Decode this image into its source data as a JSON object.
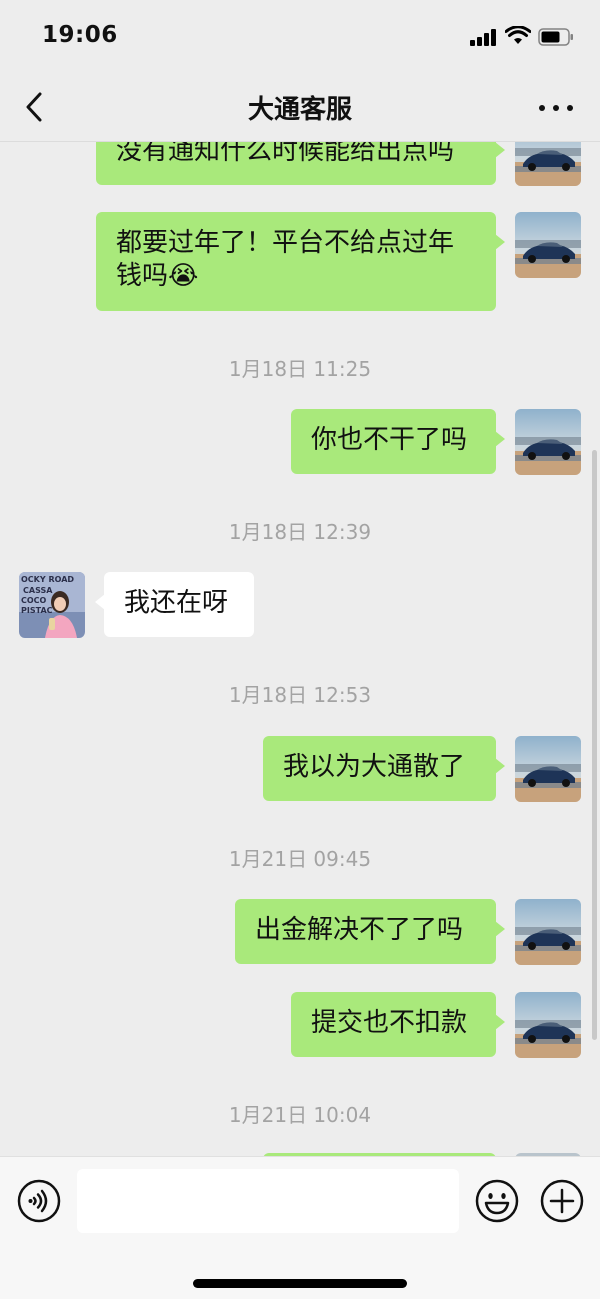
{
  "status": {
    "time": "19:06"
  },
  "nav": {
    "title": "大通客服"
  },
  "messages": [
    {
      "side": "mine",
      "text": "没有通知什么时候能给出点吗"
    },
    {
      "side": "mine",
      "text": "都要过年了！平台不给点过年钱吗😭"
    },
    {
      "type": "timestamp",
      "text": "1月18日 11:25"
    },
    {
      "side": "mine",
      "text": "你也不干了吗"
    },
    {
      "type": "timestamp",
      "text": "1月18日 12:39"
    },
    {
      "side": "other",
      "text": "我还在呀"
    },
    {
      "type": "timestamp",
      "text": "1月18日 12:53"
    },
    {
      "side": "mine",
      "text": "我以为大通散了"
    },
    {
      "type": "timestamp",
      "text": "1月21日 09:45"
    },
    {
      "side": "mine",
      "text": "出金解决不了了吗"
    },
    {
      "side": "mine",
      "text": "提交也不扣款"
    },
    {
      "type": "timestamp",
      "text": "1月21日 10:04"
    }
  ],
  "other_avatar_text": "OCKY ROAD CASSA COCO PISTAC",
  "input": {
    "placeholder": ""
  },
  "colors": {
    "my_bubble": "#a9e97b",
    "other_bubble": "#ffffff",
    "background": "#ededed"
  }
}
